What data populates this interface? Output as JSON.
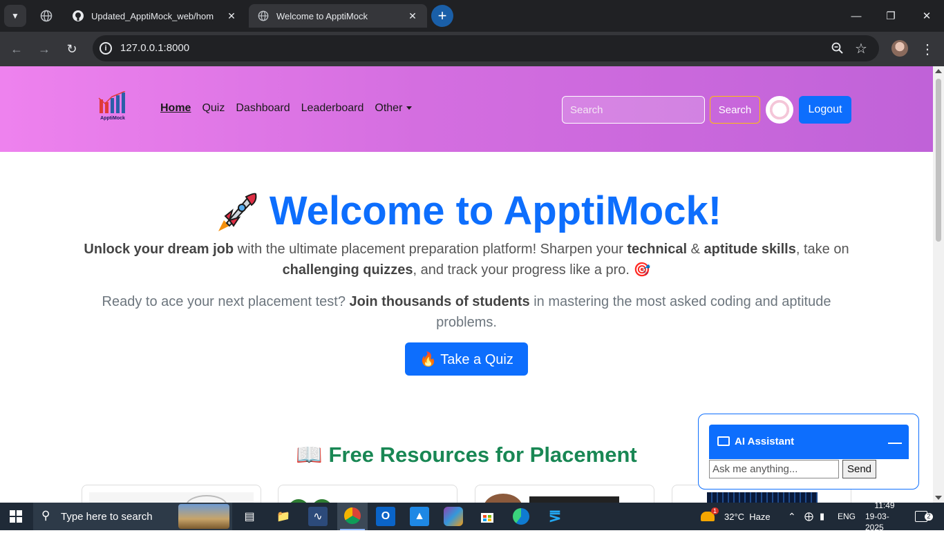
{
  "browser": {
    "tabs": [
      {
        "title": "Updated_ApptiMock_web/hom",
        "active": false
      },
      {
        "title": "Welcome to ApptiMock",
        "active": true
      }
    ],
    "url": "127.0.0.1:8000"
  },
  "site": {
    "logo_text": "ApptiMock",
    "nav": {
      "links": [
        "Home",
        "Quiz",
        "Dashboard",
        "Leaderboard",
        "Other"
      ]
    },
    "search": {
      "placeholder": "Search",
      "button": "Search"
    },
    "logout": "Logout"
  },
  "hero": {
    "title": "Welcome to ApptiMock!",
    "p1": {
      "b1": "Unlock your dream job",
      "t1": " with the ultimate placement preparation platform! Sharpen your ",
      "b2": "technical",
      "t2": " & ",
      "b3": "aptitude skills",
      "t3": ", take on ",
      "b4": "challenging quizzes",
      "t4": ", and track your progress like a pro. 🎯"
    },
    "p2": {
      "t1": "Ready to ace your next placement test? ",
      "b1": "Join thousands of students",
      "t2": " in mastering the most asked coding and aptitude problems."
    },
    "cta": "🔥 Take a Quiz"
  },
  "resources": {
    "title": "📖 Free Resources for Placement"
  },
  "ai": {
    "title": "AI Assistant",
    "placeholder": "Ask me anything...",
    "send": "Send"
  },
  "taskbar": {
    "search_placeholder": "Type here to search",
    "weather": "32°C  Haze",
    "weather_badge": "1",
    "lang": "ENG",
    "time": "11:49",
    "date": "19-03-2025",
    "notifications": "2"
  },
  "colors": {
    "primary": "#0d6efd",
    "success": "#198754",
    "nav_gradient_start": "#ee82ee",
    "nav_gradient_end": "#c062d8"
  }
}
